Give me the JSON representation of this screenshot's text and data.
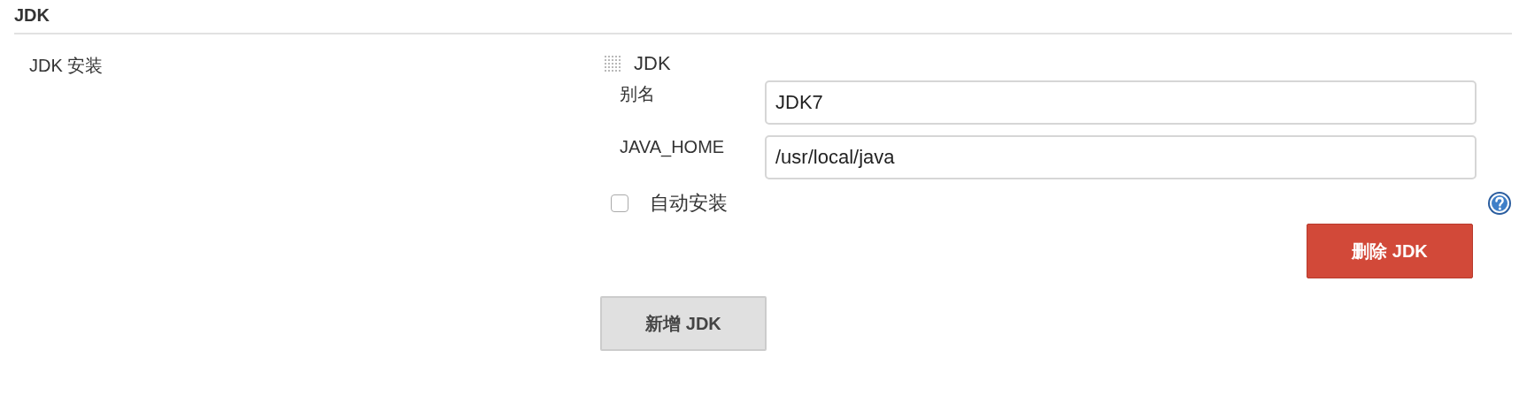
{
  "section": {
    "title": "JDK"
  },
  "setting": {
    "label": "JDK 安装"
  },
  "installation": {
    "title": "JDK",
    "fields": [
      {
        "label": "别名",
        "value": "JDK7"
      },
      {
        "label": "JAVA_HOME",
        "value": "/usr/local/java"
      }
    ],
    "auto_install": {
      "label": "自动安装",
      "checked": false
    },
    "delete_button": "删除 JDK"
  },
  "add_button": "新增 JDK"
}
